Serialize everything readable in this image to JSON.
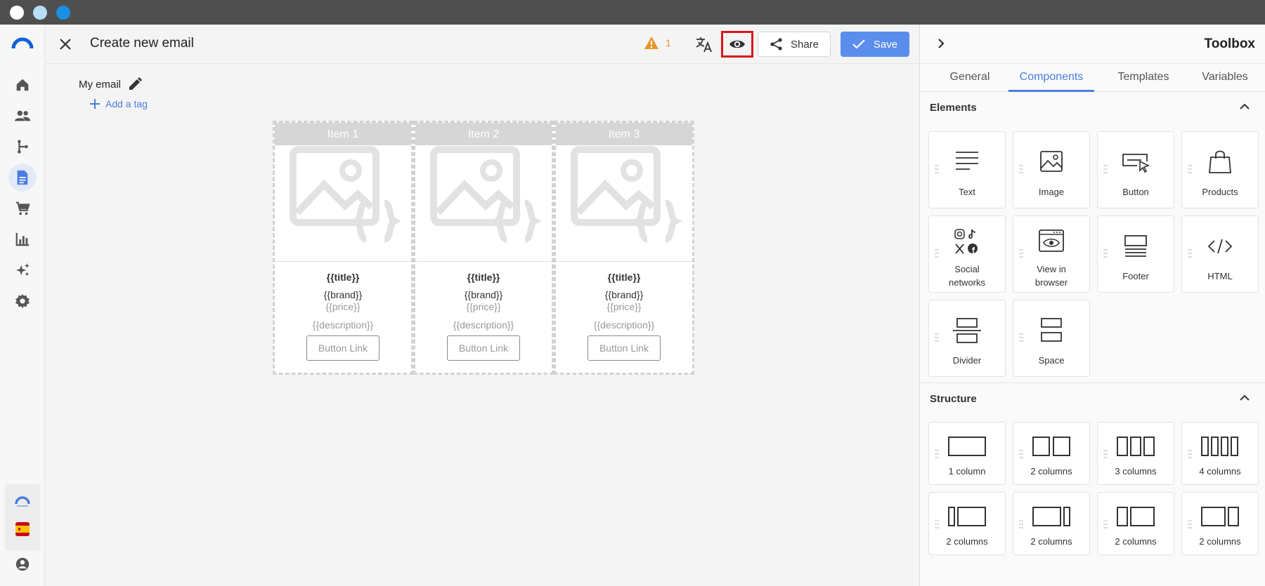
{
  "window": {
    "dots": [
      "#ffffff",
      "#b8ddf7",
      "#1a8fe3"
    ]
  },
  "header": {
    "title": "Create new email",
    "warning_count": "1",
    "share_label": "Share",
    "save_label": "Save"
  },
  "canvas": {
    "email_name": "My email",
    "add_tag": "Add a tag",
    "products": [
      {
        "item": "Item 1",
        "title": "{{title}}",
        "brand": "{{brand}}",
        "price": "{{price}}",
        "description": "{{description}}",
        "button": "Button Link"
      },
      {
        "item": "Item 2",
        "title": "{{title}}",
        "brand": "{{brand}}",
        "price": "{{price}}",
        "description": "{{description}}",
        "button": "Button Link"
      },
      {
        "item": "Item 3",
        "title": "{{title}}",
        "brand": "{{brand}}",
        "price": "{{price}}",
        "description": "{{description}}",
        "button": "Button Link"
      }
    ]
  },
  "nav": {
    "items": [
      "home-icon",
      "contacts-icon",
      "automation-icon",
      "document-icon",
      "cart-icon",
      "reports-icon",
      "ai-sparkle-icon",
      "settings-icon"
    ],
    "active": "document-icon",
    "bottom": [
      "brand-logo-icon",
      "spain-flag-icon",
      "account-icon"
    ]
  },
  "toolbox": {
    "title": "Toolbox",
    "tabs": [
      "General",
      "Components",
      "Templates",
      "Variables"
    ],
    "active_tab": "Components",
    "elements_title": "Elements",
    "elements": [
      "Text",
      "Image",
      "Button",
      "Products",
      "Social networks",
      "View in browser",
      "Footer",
      "HTML",
      "Divider",
      "Space"
    ],
    "structure_title": "Structure",
    "structure": [
      "1 column",
      "2 columns",
      "3 columns",
      "4 columns",
      "2 columns",
      "2 columns",
      "2 columns",
      "2 columns"
    ]
  },
  "colors": {
    "accent": "#4a7de0",
    "save": "#5b8ded",
    "warning": "#e8952a",
    "highlight": "#d8161b"
  }
}
